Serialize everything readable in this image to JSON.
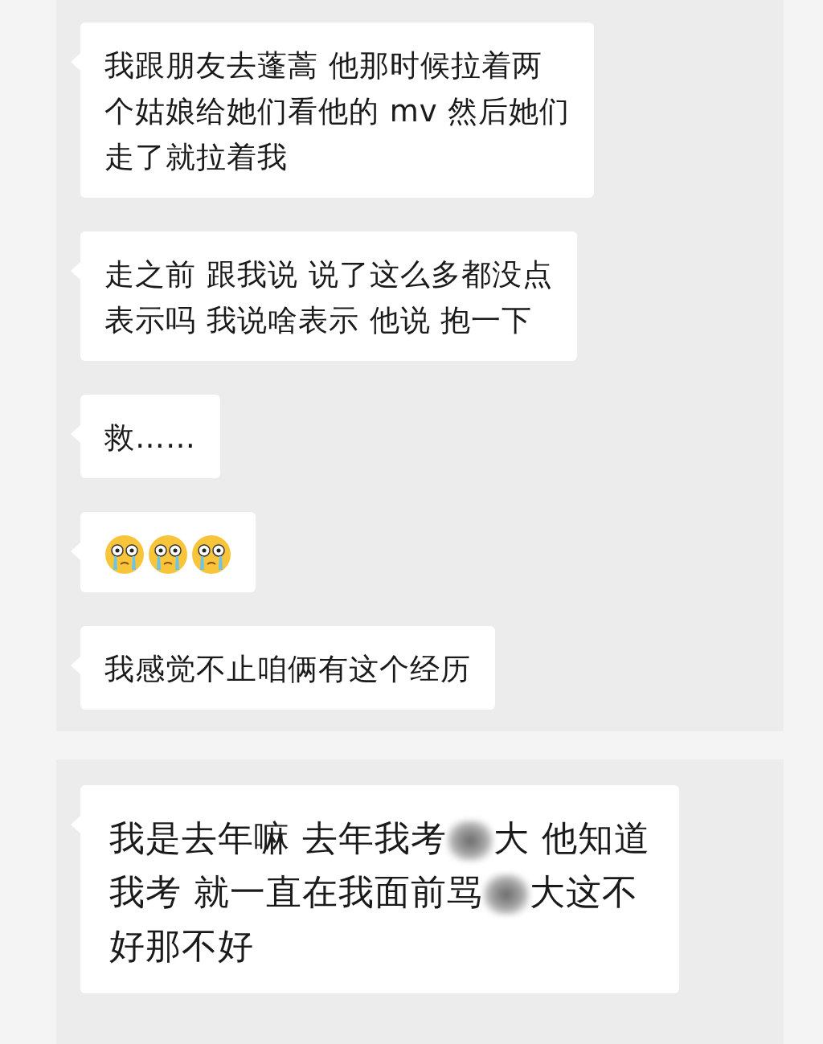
{
  "panels": [
    {
      "messages": [
        {
          "kind": "text",
          "lines": [
            "我跟朋友去蓬蒿 他那时候拉着两",
            "个姑娘给她们看他的 mv 然后她们",
            "走了就拉着我"
          ]
        },
        {
          "kind": "text",
          "lines": [
            "走之前 跟我说 说了这么多都没点",
            "表示吗 我说啥表示 他说 抱一下"
          ]
        },
        {
          "kind": "text",
          "lines": [
            "救……"
          ]
        },
        {
          "kind": "emoji",
          "emojis": [
            {
              "kind": "crying"
            },
            {
              "kind": "crying"
            },
            {
              "kind": "crying"
            }
          ]
        },
        {
          "kind": "text",
          "lines": [
            "我感觉不止咱俩有这个经历"
          ]
        }
      ]
    },
    {
      "messages": [
        {
          "kind": "segments",
          "lines": [
            [
              {
                "kind": "text",
                "text": "我是去年嘛 去年我考"
              },
              {
                "kind": "redaction"
              },
              {
                "kind": "text",
                "text": "大 他知道"
              }
            ],
            [
              {
                "kind": "text",
                "text": "我考 就一直在我面前骂"
              },
              {
                "kind": "redaction"
              },
              {
                "kind": "text",
                "text": "大这不"
              }
            ],
            [
              {
                "kind": "text",
                "text": "好那不好"
              }
            ]
          ]
        }
      ]
    }
  ]
}
